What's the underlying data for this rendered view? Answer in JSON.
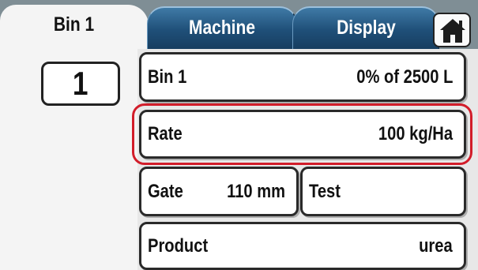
{
  "tabs": [
    {
      "label": "Bin 1",
      "active": true
    },
    {
      "label": "Machine",
      "active": false
    },
    {
      "label": "Display",
      "active": false
    }
  ],
  "home_icon": "home-icon",
  "bin_selector": {
    "value": "1"
  },
  "rows": {
    "bin": {
      "label": "Bin 1",
      "value": "0% of 2500 L"
    },
    "rate": {
      "label": "Rate",
      "value": "100 kg/Ha"
    },
    "gate": {
      "label": "Gate",
      "value": "110 mm"
    },
    "test": {
      "label": "Test"
    },
    "product": {
      "label": "Product",
      "value": "urea"
    }
  },
  "colors": {
    "highlight": "#d21d2a",
    "tab_dark": "#1f4f78",
    "topbar": "#7f8e95"
  }
}
